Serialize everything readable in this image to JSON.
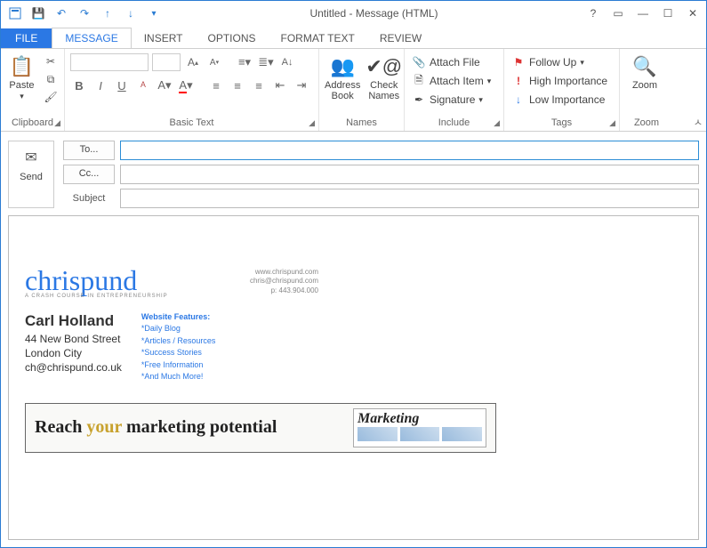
{
  "window_title": "Untitled - Message (HTML)",
  "tabs": {
    "file": "FILE",
    "message": "MESSAGE",
    "insert": "INSERT",
    "options": "OPTIONS",
    "format": "FORMAT TEXT",
    "review": "REVIEW"
  },
  "groups": {
    "clipboard": {
      "label": "Clipboard",
      "paste": "Paste"
    },
    "basic_text": {
      "label": "Basic Text"
    },
    "names": {
      "label": "Names",
      "address": "Address Book",
      "check": "Check Names"
    },
    "include": {
      "label": "Include",
      "attach_file": "Attach File",
      "attach_item": "Attach Item",
      "signature": "Signature"
    },
    "tags": {
      "label": "Tags",
      "follow": "Follow Up",
      "high": "High Importance",
      "low": "Low Importance"
    },
    "zoom": {
      "label": "Zoom",
      "zoom": "Zoom"
    }
  },
  "header": {
    "send": "Send",
    "to": "To...",
    "cc": "Cc...",
    "subject": "Subject",
    "to_val": "",
    "cc_val": "",
    "subject_val": ""
  },
  "signature": {
    "logo": "chrispund",
    "logo_sub": "A CRASH COURSE IN ENTREPRENEURSHIP",
    "site": "www.chrispund.com",
    "email": "chris@chrispund.com",
    "phone": "p: 443.904.000",
    "name": "Carl Holland",
    "addr1": "44 New Bond Street",
    "addr2": "London City",
    "email2": "ch@chrispund.co.uk",
    "feat_hd": "Website Features:",
    "feats": [
      "*Daily Blog",
      "*Articles / Resources",
      "*Success Stories",
      "*Free Information",
      "*And Much More!"
    ]
  },
  "banner": {
    "pre": "Reach ",
    "em": "your",
    "post": " marketing potential",
    "mag": "Marketing"
  }
}
